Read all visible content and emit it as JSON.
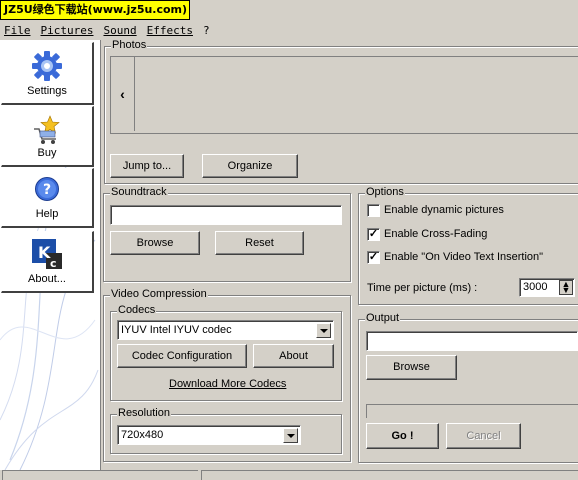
{
  "watermark": "JZ5U绿色下载站(www.jz5u.com)",
  "menu": [
    {
      "label": "File"
    },
    {
      "label": "Pictures"
    },
    {
      "label": "Sound"
    },
    {
      "label": "Effects"
    },
    {
      "label": "?"
    }
  ],
  "sidebar": {
    "items": [
      {
        "label": "Settings",
        "icon": "gear-icon"
      },
      {
        "label": "Buy",
        "icon": "cart-star-icon"
      },
      {
        "label": "Help",
        "icon": "help-icon"
      },
      {
        "label": "About...",
        "icon": "kc-logo-icon"
      }
    ]
  },
  "photos": {
    "title": "Photos",
    "scroll_left": "‹",
    "jump_button": "Jump to...",
    "organize_button": "Organize"
  },
  "soundtrack": {
    "title": "Soundtrack",
    "value": "",
    "browse_button": "Browse",
    "reset_button": "Reset"
  },
  "options": {
    "title": "Options",
    "checkboxes": [
      {
        "label": "Enable dynamic pictures",
        "checked": false
      },
      {
        "label": "Enable Cross-Fading",
        "checked": true
      },
      {
        "label": "Enable \"On Video Text Insertion\"",
        "checked": true
      }
    ],
    "time_label": "Time per picture (ms) :",
    "time_value": "3000"
  },
  "video_compression": {
    "title": "Video Compression",
    "codecs_title": "Codecs",
    "codec_selected": "IYUV Intel IYUV codec",
    "codec_config_button": "Codec Configuration",
    "about_button": "About",
    "download_link": "Download More Codecs",
    "resolution_title": "Resolution",
    "resolution_selected": "720x480"
  },
  "output": {
    "title": "Output",
    "value": "",
    "browse_button": "Browse",
    "go_button": "Go !",
    "cancel_button": "Cancel"
  },
  "colors": {
    "window_bg": "#d4d0c8",
    "watermark_bg": "#ffff00"
  }
}
